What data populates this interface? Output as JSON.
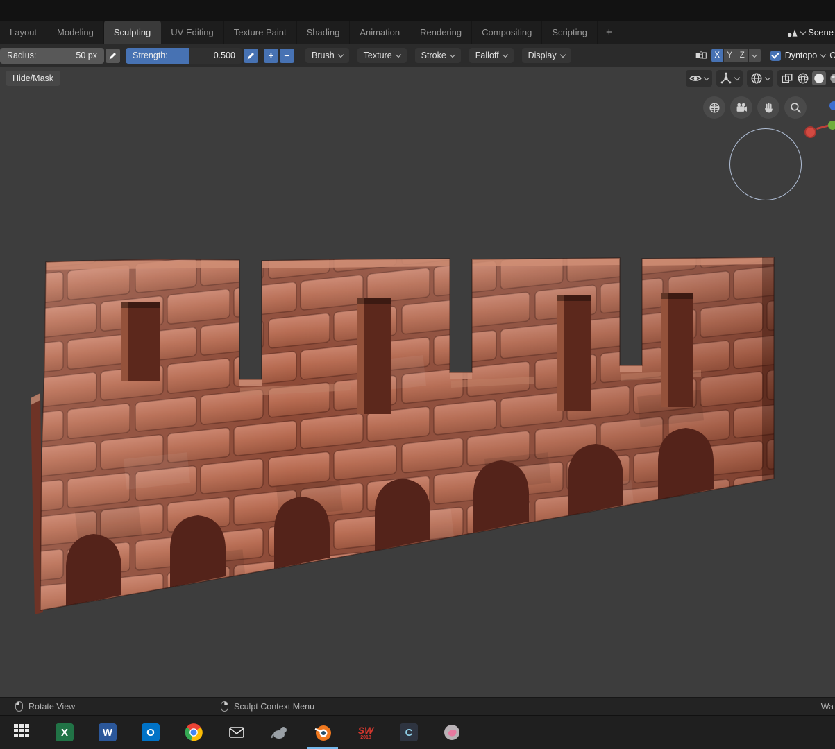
{
  "colors": {
    "accent_blue": "#4772b3",
    "active_underline": "#76b9ed",
    "topstrip_bg": "#121212",
    "tabbar_bg": "#1d1d1d",
    "tab_active_bg": "#3a3a3a",
    "toolbar_bg": "#2b2b2b",
    "viewport_bg": "#3d3d3d",
    "statusbar_bg": "#232323",
    "taskbar_bg": "#1f1f1f",
    "brick_light": "#c8836b",
    "brick_face": "#b5684e",
    "brick_dark": "#7e3a2a",
    "brick_shadow": "#54231a",
    "mortar": "#8d4a37"
  },
  "topbar": {
    "tabs": [
      {
        "label": "Layout"
      },
      {
        "label": "Modeling"
      },
      {
        "label": "Sculpting"
      },
      {
        "label": "UV Editing"
      },
      {
        "label": "Texture Paint"
      },
      {
        "label": "Shading"
      },
      {
        "label": "Animation"
      },
      {
        "label": "Rendering"
      },
      {
        "label": "Compositing"
      },
      {
        "label": "Scripting"
      }
    ],
    "add_tab_label": "+",
    "scene_label": "Scene"
  },
  "tool_settings": {
    "radius_label": "Radius:",
    "radius_value": "50 px",
    "strength_label": "Strength:",
    "strength_value": "0.500",
    "add_label": "+",
    "subtract_label": "−",
    "menus": [
      {
        "label": "Brush"
      },
      {
        "label": "Texture"
      },
      {
        "label": "Stroke"
      },
      {
        "label": "Falloff"
      },
      {
        "label": "Display"
      }
    ],
    "mirror_x": "X",
    "mirror_y": "Y",
    "mirror_z": "Z",
    "dyntopo_label": "Dyntopo",
    "options_partial_label": "O"
  },
  "viewport": {
    "hide_mask_label": "Hide/Mask"
  },
  "status_bar": {
    "rotate_view_label": "Rotate View",
    "context_menu_label": "Sculpt Context Menu",
    "right_partial_label": "Wa"
  },
  "taskbar": {
    "icons": [
      {
        "name": "app-grid"
      },
      {
        "name": "excel",
        "glyph": "X"
      },
      {
        "name": "word",
        "glyph": "W"
      },
      {
        "name": "outlook",
        "glyph": "O"
      },
      {
        "name": "chrome"
      },
      {
        "name": "mail"
      },
      {
        "name": "mouse-utility"
      },
      {
        "name": "blender",
        "active": true
      },
      {
        "name": "solidworks",
        "glyph": "SW",
        "sub_glyph": "2018"
      },
      {
        "name": "clip-studio",
        "glyph": "C"
      },
      {
        "name": "paint-app"
      }
    ]
  }
}
